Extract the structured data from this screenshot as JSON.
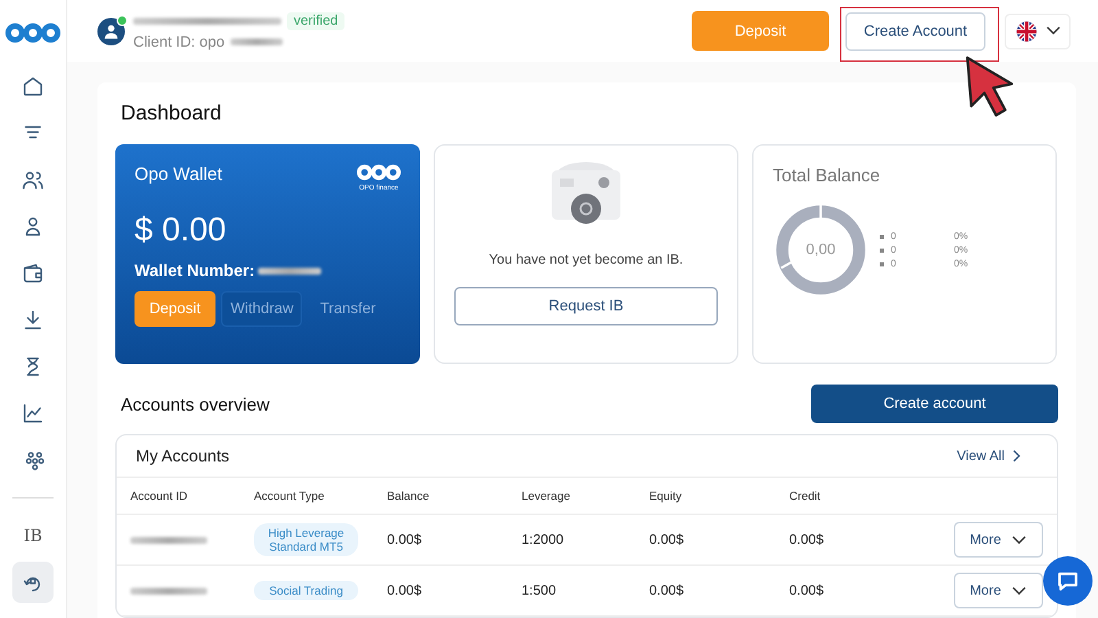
{
  "header": {
    "verified_badge": "verified",
    "client_id": "Client ID: opo",
    "deposit_button": "Deposit",
    "create_account_button": "Create Account"
  },
  "sidebar": {
    "items": [
      {
        "selected": false
      },
      {
        "selected": false
      },
      {
        "selected": false
      },
      {
        "selected": false
      },
      {
        "selected": false
      },
      {
        "selected": false
      },
      {
        "selected": false
      },
      {
        "selected": false
      },
      {
        "selected": false
      },
      {
        "label": "IB",
        "selected": false
      },
      {
        "selected": true
      }
    ]
  },
  "dashboard": {
    "title": "Dashboard",
    "wallet": {
      "title": "Opo Wallet",
      "logo_caption": "OPO finance",
      "amount": "$ 0.00",
      "number_label": "Wallet Number:",
      "buttons": [
        {
          "label": "Deposit",
          "disabled": false
        },
        {
          "label": "Withdraw",
          "disabled": true
        },
        {
          "label": "Transfer",
          "disabled": true
        }
      ]
    },
    "ib": {
      "message": "You have not yet become an IB.",
      "button": "Request IB"
    },
    "balance": {
      "title": "Total Balance",
      "center": "0,00",
      "legend": [
        {
          "value": "0",
          "share": "0%"
        },
        {
          "value": "0",
          "share": "0%"
        },
        {
          "value": "0",
          "share": "0%"
        }
      ]
    }
  },
  "accounts": {
    "title": "Accounts overview",
    "create_button": "Create account",
    "card_title": "My Accounts",
    "view_all": "View All",
    "columns": [
      "Account ID",
      "Account Type",
      "Balance",
      "Leverage",
      "Equity",
      "Credit"
    ],
    "rows": [
      {
        "type": "High Leverage Standard MT5",
        "balance": "0.00$",
        "leverage": "1:2000",
        "equity": "0.00$",
        "credit": "0.00$",
        "action": "More"
      },
      {
        "type": "Social Trading",
        "balance": "0.00$",
        "leverage": "1:500",
        "equity": "0.00$",
        "credit": "0.00$",
        "action": "More"
      }
    ]
  }
}
